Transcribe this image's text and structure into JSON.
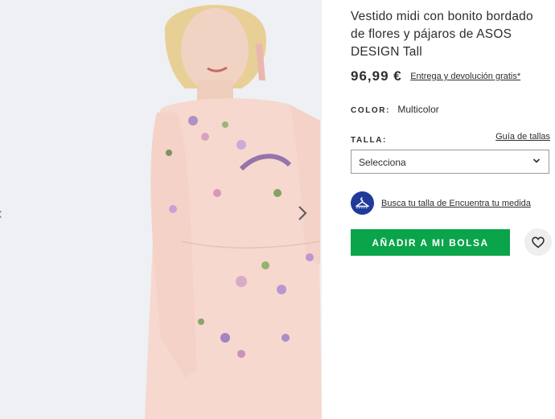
{
  "product": {
    "title": "Vestido midi con bonito bordado de flores y pájaros de ASOS DESIGN Tall",
    "price": "96,99 €",
    "delivery_note": "Entrega y devolución gratis*"
  },
  "color": {
    "label": "COLOR:",
    "value": "Multicolor"
  },
  "size": {
    "label": "TALLA:",
    "guide_link": "Guía de tallas",
    "select_value": "Selecciona"
  },
  "fit": {
    "link": "Busca tu talla de Encuentra tu medida",
    "icon": "hanger-icon"
  },
  "actions": {
    "add_to_bag": "AÑADIR A MI BOLSA",
    "save_icon": "heart-icon"
  },
  "colors": {
    "add_button": "#0aa44a",
    "fit_icon_bg": "#1f3a9a",
    "dress": "#f6d8cf",
    "background": "#eef0f3"
  }
}
